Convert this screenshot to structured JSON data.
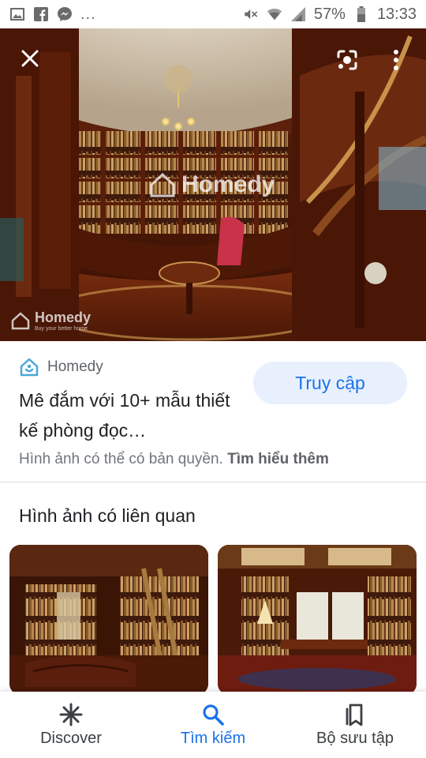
{
  "status_bar": {
    "left_icons": [
      "image-icon",
      "facebook-icon",
      "messenger-icon"
    ],
    "more": "...",
    "battery_percent": "57%",
    "time": "13:33",
    "right_icons": [
      "mute-icon",
      "wifi-icon",
      "signal-icon",
      "battery-icon"
    ]
  },
  "hero": {
    "watermark": "Homedy",
    "watermark_small": "Homedy",
    "watermark_tag": "Buy your better home"
  },
  "result": {
    "source": "Homedy",
    "visit_label": "Truy cập",
    "title": "Mê đắm với 10+ mẫu thiết kế phòng đọc…",
    "copyright_text": "Hình ảnh có thể có bản quyền.",
    "learn_more": "Tìm hiểu thêm"
  },
  "related": {
    "heading": "Hình ảnh có liên quan"
  },
  "bottom_nav": {
    "items": [
      {
        "label": "Discover",
        "icon": "asterisk-icon"
      },
      {
        "label": "Tìm kiếm",
        "icon": "search-icon"
      },
      {
        "label": "Bộ sưu tập",
        "icon": "collections-icon"
      }
    ],
    "active_index": 1
  },
  "colors": {
    "accent": "#1a73e8",
    "visit_bg": "#e8f0fe",
    "wood": "#6b2a10"
  }
}
